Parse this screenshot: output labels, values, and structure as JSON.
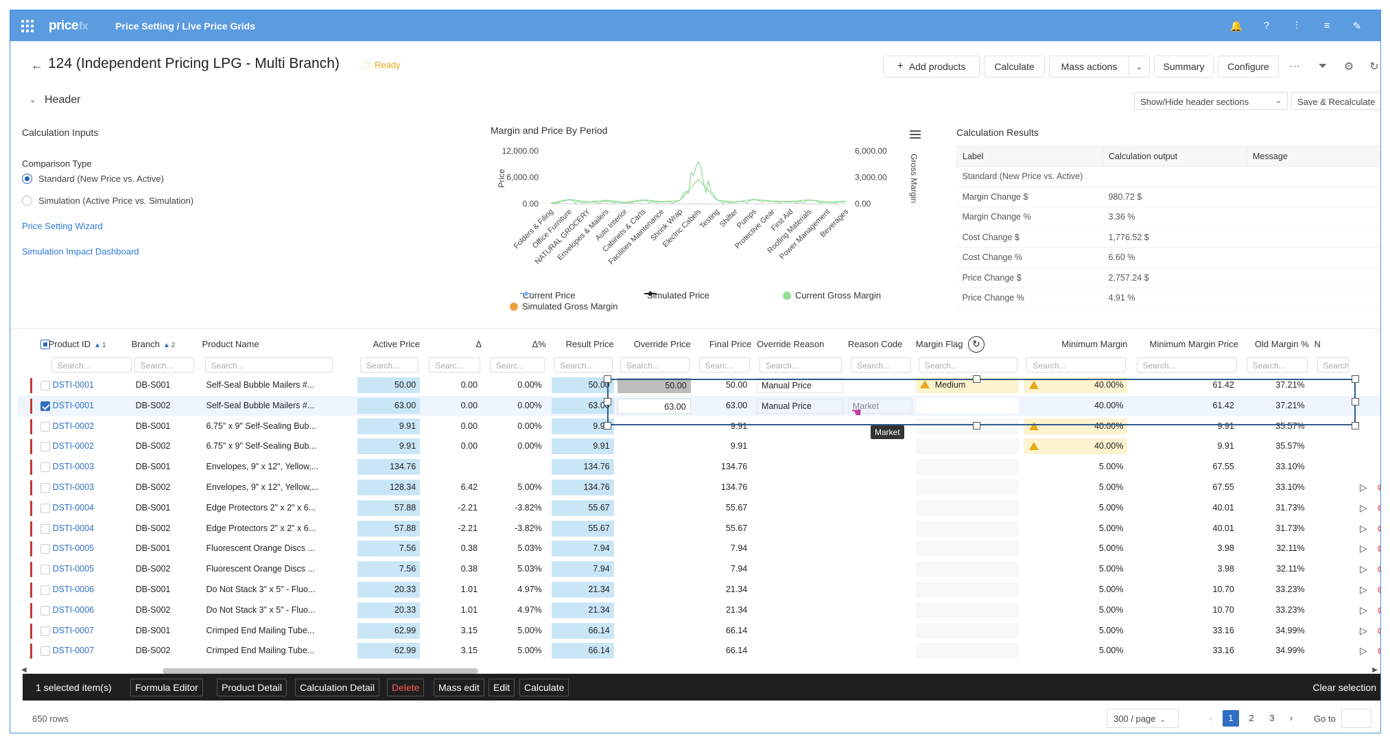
{
  "topbar": {
    "logo": "price",
    "logo_suffix": "fx",
    "breadcrumb": "Price Setting / Live Price Grids"
  },
  "title": {
    "text": "124 (Independent Pricing LPG - Multi Branch)",
    "status": "Ready"
  },
  "toolbar": {
    "add_products": "Add products",
    "calculate": "Calculate",
    "mass_actions": "Mass actions",
    "summary": "Summary",
    "configure": "Configure",
    "more": "···"
  },
  "header": {
    "label": "Header",
    "show_hide": "Show/Hide header sections",
    "save_recalc": "Save & Recalculate"
  },
  "inputs": {
    "title": "Calculation Inputs",
    "comparison_label": "Comparison Type",
    "options": [
      "Standard (New Price vs. Active)",
      "Simulation (Active Price vs. Simulation)"
    ],
    "selected": 0,
    "links": [
      "Price Setting Wizard",
      "Simulation Impact Dashboard"
    ]
  },
  "chart_data": {
    "type": "line",
    "title": "Margin and Price By Period",
    "ylabel": "Price",
    "y2label": "Gross Margin",
    "ylim": [
      0,
      12000
    ],
    "y2lim": [
      0,
      6000
    ],
    "yticks": [
      "12,000.00",
      "6,000.00",
      "0.00"
    ],
    "y2ticks": [
      "6,000.00",
      "3,000.00",
      "0.00"
    ],
    "categories": [
      "Folders & Filing",
      "Office Furniture",
      "NATURAL GROCERY",
      "Envelopes & Mailers",
      "Auto Interior",
      "Cabinets & Carts",
      "Facilities Maintenance",
      "Shrink Wrap",
      "Electric Cabels",
      "Testing",
      "Shifter",
      "Pumps",
      "Protective Gear",
      "First Aid",
      "Roofing Materials",
      "Power Management",
      "Beverages"
    ],
    "series": [
      {
        "name": "Current Price",
        "values": [
          100,
          900,
          300,
          600,
          200,
          800,
          400,
          600,
          9500,
          700,
          300,
          900,
          500,
          400,
          800,
          300,
          500
        ]
      },
      {
        "name": "Simulated Price",
        "values": [
          100,
          900,
          300,
          600,
          200,
          800,
          400,
          600,
          9500,
          700,
          300,
          900,
          500,
          400,
          800,
          300,
          500
        ]
      },
      {
        "name": "Current Gross Margin",
        "values": [
          80,
          500,
          200,
          400,
          150,
          450,
          250,
          350,
          2800,
          400,
          200,
          500,
          300,
          250,
          450,
          200,
          300
        ]
      },
      {
        "name": "Simulated Gross Margin",
        "values": [
          80,
          500,
          200,
          400,
          150,
          450,
          250,
          350,
          2800,
          400,
          200,
          500,
          300,
          250,
          450,
          200,
          300
        ]
      }
    ],
    "legend": "bottom",
    "colors": {
      "current_price": "#8ab4e8",
      "simulated_price": "#222222",
      "current_margin": "#90e090",
      "simulated_margin": "#f0a040"
    }
  },
  "results": {
    "title": "Calculation Results",
    "headers": [
      "Label",
      "Calculation output",
      "Message"
    ],
    "rows": [
      [
        "Standard (New Price vs. Active)",
        "",
        ""
      ],
      [
        "Margin Change $",
        "980.72 $",
        ""
      ],
      [
        "Margin Change %",
        "3.36 %",
        ""
      ],
      [
        "Cost Change $",
        "1,776.52 $",
        ""
      ],
      [
        "Cost Change %",
        "6.60 %",
        ""
      ],
      [
        "Price Change $",
        "2,757.24 $",
        ""
      ],
      [
        "Price Change %",
        "4.91 %",
        ""
      ]
    ]
  },
  "grid": {
    "columns": [
      "Product ID",
      "Branch",
      "Product Name",
      "Active Price",
      "Δ",
      "Δ%",
      "Result Price",
      "Override Price",
      "Final Price",
      "Override Reason",
      "Reason Code",
      "Margin Flag",
      "Minimum Margin",
      "Minimum Margin Price",
      "Old Margin %",
      "N"
    ],
    "sort_badges": [
      "1",
      "2"
    ],
    "filters": [
      "Search...",
      "Search...",
      "Search...",
      "Search...",
      "Searc...",
      "Searc...",
      "Search...",
      "Search...",
      "Searc...",
      "Search...",
      "Search...",
      "Search...",
      "Search...",
      "Search...",
      "Search...",
      "Search..."
    ],
    "rows": [
      {
        "id": "DSTI-0001",
        "branch": "DB-S001",
        "name": "Self-Seal Bubble Mailers #...",
        "active": "50.00",
        "delta": "0.00",
        "deltap": "0.00%",
        "result": "50.00",
        "override": "50.00",
        "final": "50.00",
        "reason": "Manual Price",
        "code": "",
        "flag": "Medium",
        "minm": "40.00%",
        "minmp": "61.42",
        "oldm": "37.21%"
      },
      {
        "id": "DSTI-0001",
        "branch": "DB-S002",
        "name": "Self-Seal Bubble Mailers #...",
        "active": "63.00",
        "delta": "0.00",
        "deltap": "0.00%",
        "result": "63.00",
        "override": "63.00",
        "final": "63.00",
        "reason": "Manual Price",
        "code": "Market",
        "flag": "",
        "minm": "40.00%",
        "minmp": "61.42",
        "oldm": "37.21%"
      },
      {
        "id": "DSTI-0002",
        "branch": "DB-S001",
        "name": "6.75\" x 9\" Self-Sealing Bub...",
        "active": "9.91",
        "delta": "0.00",
        "deltap": "0.00%",
        "result": "9.91",
        "override": "",
        "final": "9.91",
        "reason": "",
        "code": "",
        "flag": "",
        "minm": "40.00%",
        "minmp": "9.91",
        "oldm": "35.57%"
      },
      {
        "id": "DSTI-0002",
        "branch": "DB-S002",
        "name": "6.75\" x 9\" Self-Sealing Bub...",
        "active": "9.91",
        "delta": "0.00",
        "deltap": "0.00%",
        "result": "9.91",
        "override": "",
        "final": "9.91",
        "reason": "",
        "code": "",
        "flag": "",
        "minm": "40.00%",
        "minmp": "9.91",
        "oldm": "35.57%"
      },
      {
        "id": "DSTI-0003",
        "branch": "DB-S001",
        "name": "Envelopes, 9\" x 12\", Yellow,...",
        "active": "134.76",
        "delta": "",
        "deltap": "",
        "result": "134.76",
        "override": "",
        "final": "134.76",
        "reason": "",
        "code": "",
        "flag": "",
        "minm": "5.00%",
        "minmp": "67.55",
        "oldm": "33.10%"
      },
      {
        "id": "DSTI-0003",
        "branch": "DB-S002",
        "name": "Envelopes, 9\" x 12\", Yellow,...",
        "active": "128.34",
        "delta": "6.42",
        "deltap": "5.00%",
        "result": "134.76",
        "override": "",
        "final": "134.76",
        "reason": "",
        "code": "",
        "flag": "",
        "minm": "5.00%",
        "minmp": "67.55",
        "oldm": "33.10%"
      },
      {
        "id": "DSTI-0004",
        "branch": "DB-S001",
        "name": "Edge Protectors 2\" x 2\" x 6...",
        "active": "57.88",
        "delta": "-2.21",
        "deltap": "-3.82%",
        "result": "55.67",
        "override": "",
        "final": "55.67",
        "reason": "",
        "code": "",
        "flag": "",
        "minm": "5.00%",
        "minmp": "40.01",
        "oldm": "31.73%"
      },
      {
        "id": "DSTI-0004",
        "branch": "DB-S002",
        "name": "Edge Protectors 2\" x 2\" x 6...",
        "active": "57.88",
        "delta": "-2.21",
        "deltap": "-3.82%",
        "result": "55.67",
        "override": "",
        "final": "55.67",
        "reason": "",
        "code": "",
        "flag": "",
        "minm": "5.00%",
        "minmp": "40.01",
        "oldm": "31.73%"
      },
      {
        "id": "DSTI-0005",
        "branch": "DB-S001",
        "name": "Fluorescent Orange Discs ...",
        "active": "7.56",
        "delta": "0.38",
        "deltap": "5.03%",
        "result": "7.94",
        "override": "",
        "final": "7.94",
        "reason": "",
        "code": "",
        "flag": "",
        "minm": "5.00%",
        "minmp": "3.98",
        "oldm": "32.11%"
      },
      {
        "id": "DSTI-0005",
        "branch": "DB-S002",
        "name": "Fluorescent Orange Discs ...",
        "active": "7.56",
        "delta": "0.38",
        "deltap": "5.03%",
        "result": "7.94",
        "override": "",
        "final": "7.94",
        "reason": "",
        "code": "",
        "flag": "",
        "minm": "5.00%",
        "minmp": "3.98",
        "oldm": "32.11%"
      },
      {
        "id": "DSTI-0006",
        "branch": "DB-S001",
        "name": "Do Not Stack 3\" x 5\" - Fluo...",
        "active": "20.33",
        "delta": "1.01",
        "deltap": "4.97%",
        "result": "21.34",
        "override": "",
        "final": "21.34",
        "reason": "",
        "code": "",
        "flag": "",
        "minm": "5.00%",
        "minmp": "10.70",
        "oldm": "33.23%"
      },
      {
        "id": "DSTI-0006",
        "branch": "DB-S002",
        "name": "Do Not Stack 3\" x 5\" - Fluo...",
        "active": "20.33",
        "delta": "1.01",
        "deltap": "4.97%",
        "result": "21.34",
        "override": "",
        "final": "21.34",
        "reason": "",
        "code": "",
        "flag": "",
        "minm": "5.00%",
        "minmp": "10.70",
        "oldm": "33.23%"
      },
      {
        "id": "DSTI-0007",
        "branch": "DB-S001",
        "name": "Crimped End Mailing Tube...",
        "active": "62.99",
        "delta": "3.15",
        "deltap": "5.00%",
        "result": "66.14",
        "override": "",
        "final": "66.14",
        "reason": "",
        "code": "",
        "flag": "",
        "minm": "5.00%",
        "minmp": "33.16",
        "oldm": "34.99%"
      },
      {
        "id": "DSTI-0007",
        "branch": "DB-S002",
        "name": "Crimped End Mailing Tube...",
        "active": "62.99",
        "delta": "3.15",
        "deltap": "5.00%",
        "result": "66.14",
        "override": "",
        "final": "66.14",
        "reason": "",
        "code": "",
        "flag": "",
        "minm": "5.00%",
        "minmp": "33.16",
        "oldm": "34.99%"
      }
    ],
    "tooltip": "Market"
  },
  "bottombar": {
    "selected": "1 selected item(s)",
    "buttons": [
      "Formula Editor",
      "Product Detail",
      "Calculation Detail",
      "Delete",
      "Mass edit",
      "Edit",
      "Calculate"
    ],
    "clear": "Clear selection"
  },
  "footer": {
    "rows": "650 rows",
    "per_page": "300 / page",
    "pages": [
      "1",
      "2",
      "3"
    ],
    "current_page": "1",
    "goto": "Go to"
  }
}
